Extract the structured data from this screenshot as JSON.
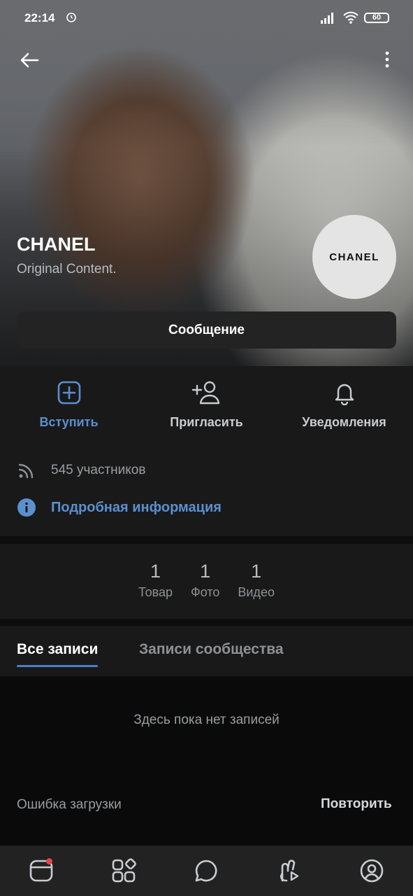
{
  "status_bar": {
    "time": "22:14",
    "battery": "60"
  },
  "header": {
    "back_icon": "arrow-left-icon",
    "more_icon": "more-vertical-icon"
  },
  "community": {
    "name": "CHANEL",
    "description": "Original Content.",
    "avatar_text": "CHANEL",
    "message_button": "Сообщение"
  },
  "actions": [
    {
      "label": "Вступить",
      "icon": "plus-square-icon"
    },
    {
      "label": "Пригласить",
      "icon": "user-add-icon"
    },
    {
      "label": "Уведомления",
      "icon": "bell-icon"
    }
  ],
  "details": {
    "members": "545 участников",
    "more_info": "Подробная информация"
  },
  "counters": [
    {
      "num": "1",
      "label": "Товар"
    },
    {
      "num": "1",
      "label": "Фото"
    },
    {
      "num": "1",
      "label": "Видео"
    }
  ],
  "tabs": {
    "all_posts": "Все записи",
    "community_posts": "Записи сообщества"
  },
  "feed": {
    "empty_text": "Здесь пока нет записей",
    "error_text": "Ошибка загрузки",
    "retry_label": "Повторить"
  },
  "bottom_nav": [
    "news-icon",
    "services-icon",
    "messages-icon",
    "clips-icon",
    "profile-icon"
  ],
  "colors": {
    "accent": "#5b8fd0",
    "background": "#19191a",
    "notification_dot": "#e64646"
  }
}
